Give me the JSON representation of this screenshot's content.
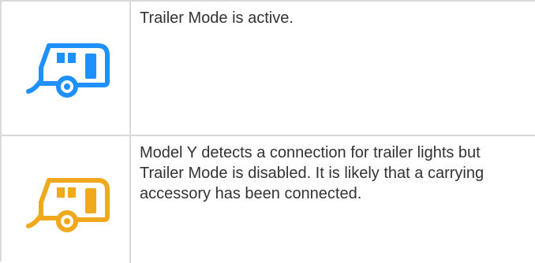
{
  "rows": [
    {
      "icon": "trailer-icon",
      "icon_color": "#1e90ff",
      "text": "Trailer Mode is active."
    },
    {
      "icon": "trailer-icon",
      "icon_color": "#f0a81c",
      "text": "Model Y detects a connection for trailer lights but Trailer Mode is disabled. It is likely that a carrying accessory has been connected."
    }
  ],
  "colors": {
    "border": "#d9d9d9",
    "text": "#333333"
  }
}
